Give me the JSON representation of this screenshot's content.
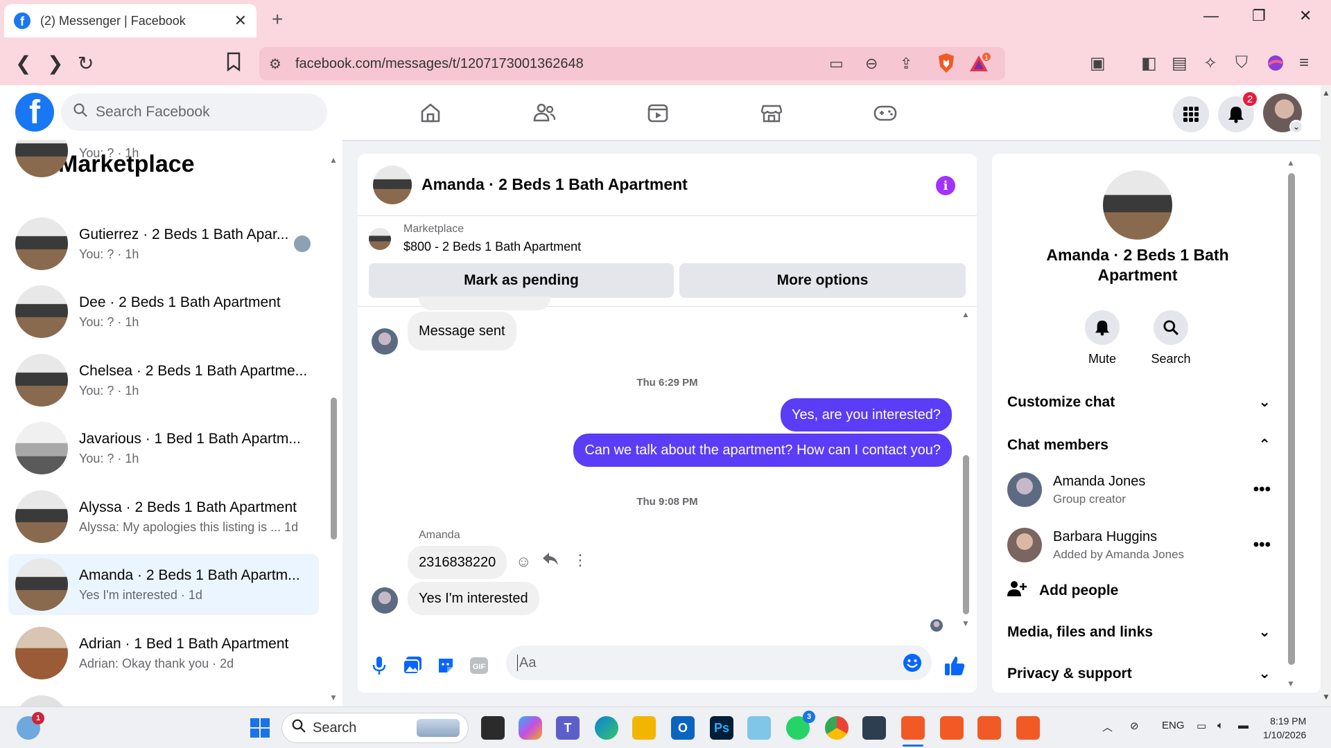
{
  "browser": {
    "tab_title": "(2) Messenger | Facebook",
    "url": "facebook.com/messages/t/1207173001362648",
    "extension_badge": "1"
  },
  "header": {
    "search_placeholder": "Search Facebook",
    "notifications_count": "2"
  },
  "sidebar": {
    "title": "Marketplace",
    "conversations": [
      {
        "name": "",
        "sub": "You: ? · 1h",
        "thumb": "apt"
      },
      {
        "name": "Gutierrez · 2 Beds 1 Bath Apar...",
        "sub": "You: ? · 1h",
        "thumb": "apt"
      },
      {
        "name": "Dee · 2 Beds 1 Bath Apartment",
        "sub": "You: ? · 1h",
        "thumb": "apt"
      },
      {
        "name": "Chelsea · 2 Beds 1 Bath Apartme...",
        "sub": "You: ? · 1h",
        "thumb": "apt"
      },
      {
        "name": "Javarious · 1 Bed 1 Bath Apartm...",
        "sub": "You: ? · 1h",
        "thumb": "apt2"
      },
      {
        "name": "Alyssa · 2 Beds 1 Bath Apartment",
        "sub": "Alyssa: My apologies this listing is ...  1d",
        "thumb": "apt"
      },
      {
        "name": "Amanda · 2 Beds 1 Bath Apartm...",
        "sub": "Yes I'm interested · 1d",
        "thumb": "apt",
        "active": true
      },
      {
        "name": "Adrian · 1 Bed 1 Bath Apartment",
        "sub": "Adrian: Okay thank you · 2d",
        "thumb": "apt3"
      },
      {
        "name": "",
        "sub": "",
        "thumb": "apt4"
      }
    ]
  },
  "chat": {
    "title": "Amanda · 2 Beds 1 Bath Apartment",
    "listing_source": "Marketplace",
    "listing": "$800 - 2 Beds 1 Bath Apartment",
    "mark_pending": "Mark as pending",
    "more_options": "More options",
    "messages": {
      "m1": "Message sent",
      "ts1": "Thu 6:29 PM",
      "m2": "Yes, are you interested?",
      "m3": "Can we talk about the apartment? How can I contact you?",
      "ts2": "Thu 9:08 PM",
      "sender": "Amanda",
      "m4": "2316838220",
      "m5": "Yes I'm interested"
    },
    "composer_placeholder": "Aa"
  },
  "details": {
    "name": "Amanda · 2 Beds 1 Bath Apartment",
    "mute": "Mute",
    "search": "Search",
    "customize": "Customize chat",
    "members_heading": "Chat members",
    "members": [
      {
        "name": "Amanda Jones",
        "role": "Group creator"
      },
      {
        "name": "Barbara Huggins",
        "role": "Added by Amanda Jones"
      }
    ],
    "add_people": "Add people",
    "media": "Media, files and links",
    "privacy": "Privacy & support"
  },
  "taskbar": {
    "search_label": "Search",
    "weather_badge": "1",
    "whatsapp_badge": "3",
    "lang": "ENG",
    "time": "8:19 PM",
    "date": "1/10/2026"
  },
  "colors": {
    "accent": "#5b3cf7",
    "facebook_blue": "#1877f2",
    "info_purple": "#a033ff"
  }
}
